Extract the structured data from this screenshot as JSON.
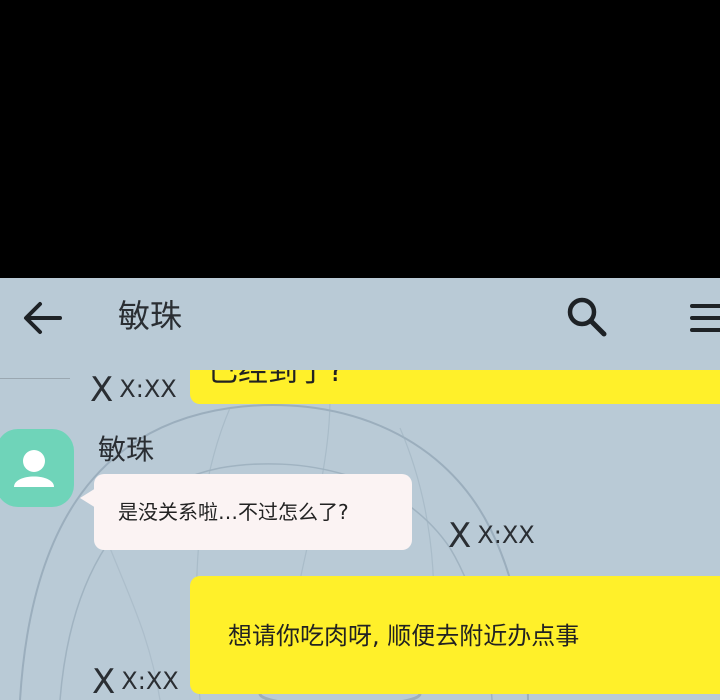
{
  "header": {
    "title": "敏珠"
  },
  "messages": {
    "top_partial": {
      "text": "已经到了?",
      "time": "X:XX"
    },
    "incoming": {
      "sender": "敏珠",
      "text": "是没关系啦…不过怎么了?",
      "time": "X:XX"
    },
    "outgoing": {
      "text": "想请你吃肉呀, 顺便去附近办点事",
      "time": "X:XX"
    }
  },
  "ts_mark": "X",
  "icons": {
    "back": "back-arrow-icon",
    "search": "search-icon",
    "menu": "menu-icon",
    "avatar": "person-icon"
  },
  "colors": {
    "chat_bg": "#b9cad6",
    "outgoing_bubble": "#fff02a",
    "incoming_bubble": "#fbf3f3",
    "avatar_bg": "#6fd4b9"
  }
}
